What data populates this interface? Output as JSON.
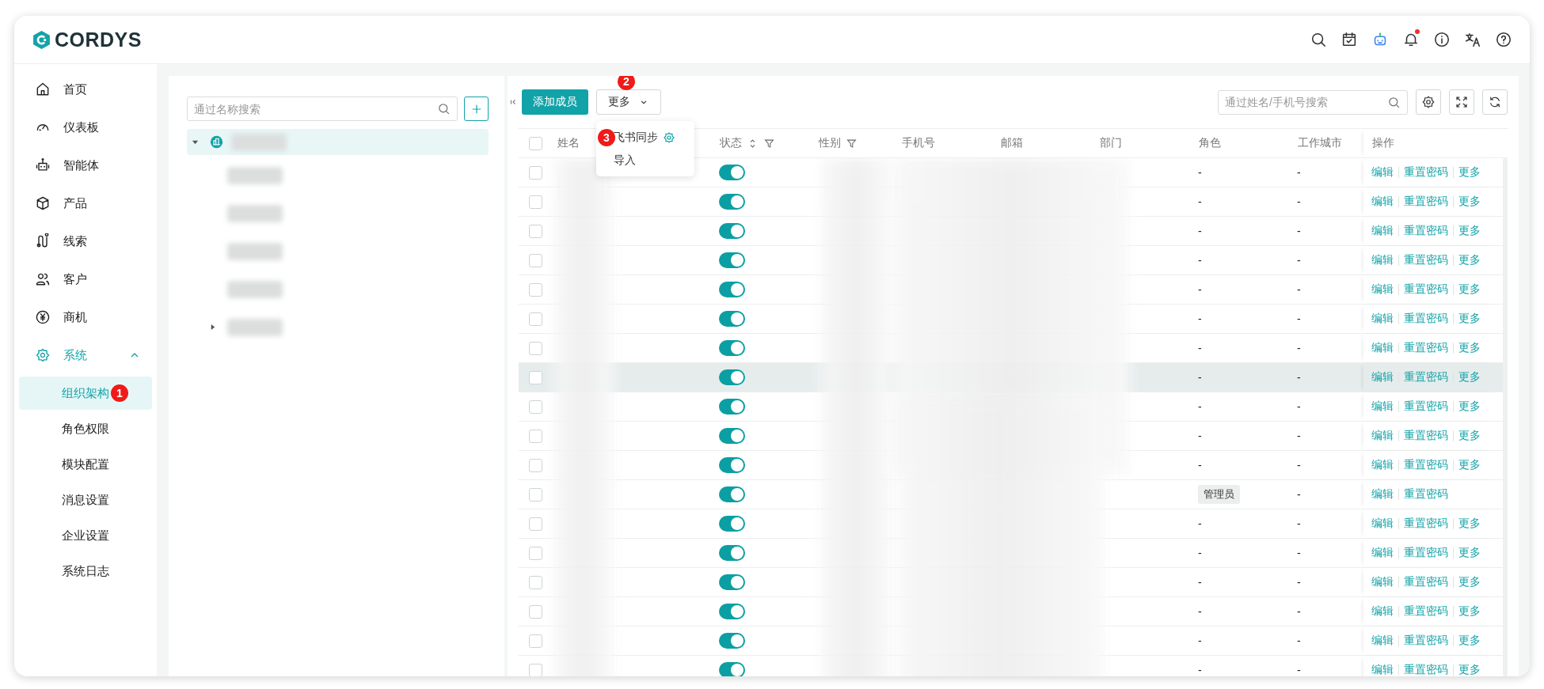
{
  "header": {
    "logo": "CORDYS",
    "notification_unread": true
  },
  "sidebar": {
    "items": [
      {
        "label": "首页",
        "selected": false
      },
      {
        "label": "仪表板",
        "selected": false
      },
      {
        "label": "智能体",
        "selected": false
      },
      {
        "label": "产品",
        "selected": false
      },
      {
        "label": "线索",
        "selected": false
      },
      {
        "label": "客户",
        "selected": false
      },
      {
        "label": "商机",
        "selected": false
      },
      {
        "label": "系统",
        "selected": true,
        "expanded": true,
        "children": [
          {
            "label": "组织架构",
            "selected": true,
            "marker": "1"
          },
          {
            "label": "角色权限",
            "selected": false
          },
          {
            "label": "模块配置",
            "selected": false
          },
          {
            "label": "消息设置",
            "selected": false
          },
          {
            "label": "企业设置",
            "selected": false
          },
          {
            "label": "系统日志",
            "selected": false
          }
        ]
      }
    ]
  },
  "tree_panel": {
    "search": {
      "placeholder": "通过名称搜索"
    },
    "tree": [
      {
        "kind": "branch",
        "expanded": true,
        "selected": true,
        "children": [
          {
            "kind": "leaf"
          },
          {
            "kind": "leaf"
          },
          {
            "kind": "leaf"
          },
          {
            "kind": "leaf"
          },
          {
            "kind": "branch",
            "expanded": false
          }
        ]
      }
    ]
  },
  "toolbar": {
    "add_button": "添加成员",
    "more_button": {
      "label": "更多",
      "marker": "2"
    },
    "more_menu": [
      {
        "label": "飞书同步",
        "marker": "3",
        "settings": true
      },
      {
        "label": "导入"
      }
    ],
    "search": {
      "placeholder": "通过姓名/手机号搜索"
    }
  },
  "table": {
    "select_all_checked": false,
    "columns": [
      {
        "label": "姓名"
      },
      {
        "label": "状态",
        "sort": true,
        "filter": true
      },
      {
        "label": "性别",
        "filter": true
      },
      {
        "label": "手机号"
      },
      {
        "label": "邮箱"
      },
      {
        "label": "部门"
      },
      {
        "label": "角色"
      },
      {
        "label": "工作城市"
      },
      {
        "label": "操作"
      }
    ],
    "rows": [
      {
        "checked": false,
        "enabled": true,
        "highlighted": false,
        "role": {
          "kind": "plain",
          "text": "-"
        },
        "city": "-",
        "actions": [
          "编辑",
          "重置密码",
          "更多"
        ]
      },
      {
        "checked": false,
        "enabled": true,
        "highlighted": false,
        "role": {
          "kind": "plain",
          "text": "-"
        },
        "city": "-",
        "actions": [
          "编辑",
          "重置密码",
          "更多"
        ]
      },
      {
        "checked": false,
        "enabled": true,
        "highlighted": false,
        "role": {
          "kind": "plain",
          "text": "-"
        },
        "city": "-",
        "actions": [
          "编辑",
          "重置密码",
          "更多"
        ]
      },
      {
        "checked": false,
        "enabled": true,
        "highlighted": false,
        "role": {
          "kind": "plain",
          "text": "-"
        },
        "city": "-",
        "actions": [
          "编辑",
          "重置密码",
          "更多"
        ]
      },
      {
        "checked": false,
        "enabled": true,
        "highlighted": false,
        "role": {
          "kind": "plain",
          "text": "-"
        },
        "city": "-",
        "actions": [
          "编辑",
          "重置密码",
          "更多"
        ]
      },
      {
        "checked": false,
        "enabled": true,
        "highlighted": false,
        "role": {
          "kind": "plain",
          "text": "-"
        },
        "city": "-",
        "actions": [
          "编辑",
          "重置密码",
          "更多"
        ]
      },
      {
        "checked": false,
        "enabled": true,
        "highlighted": false,
        "role": {
          "kind": "plain",
          "text": "-"
        },
        "city": "-",
        "actions": [
          "编辑",
          "重置密码",
          "更多"
        ]
      },
      {
        "checked": false,
        "enabled": true,
        "highlighted": true,
        "role": {
          "kind": "plain",
          "text": "-"
        },
        "city": "-",
        "actions": [
          "编辑",
          "重置密码",
          "更多"
        ]
      },
      {
        "checked": false,
        "enabled": true,
        "highlighted": false,
        "role": {
          "kind": "plain",
          "text": "-"
        },
        "city": "-",
        "actions": [
          "编辑",
          "重置密码",
          "更多"
        ]
      },
      {
        "checked": false,
        "enabled": true,
        "highlighted": false,
        "role": {
          "kind": "plain",
          "text": "-"
        },
        "city": "-",
        "actions": [
          "编辑",
          "重置密码",
          "更多"
        ]
      },
      {
        "checked": false,
        "enabled": true,
        "highlighted": false,
        "role": {
          "kind": "plain",
          "text": "-"
        },
        "city": "-",
        "actions": [
          "编辑",
          "重置密码",
          "更多"
        ]
      },
      {
        "checked": false,
        "enabled": true,
        "highlighted": false,
        "role": {
          "kind": "tag",
          "text": "管理员"
        },
        "city": "-",
        "actions": [
          "编辑",
          "重置密码"
        ]
      },
      {
        "checked": false,
        "enabled": true,
        "highlighted": false,
        "role": {
          "kind": "plain",
          "text": "-"
        },
        "city": "-",
        "actions": [
          "编辑",
          "重置密码",
          "更多"
        ]
      },
      {
        "checked": false,
        "enabled": true,
        "highlighted": false,
        "role": {
          "kind": "plain",
          "text": "-"
        },
        "city": "-",
        "actions": [
          "编辑",
          "重置密码",
          "更多"
        ]
      },
      {
        "checked": false,
        "enabled": true,
        "highlighted": false,
        "role": {
          "kind": "plain",
          "text": "-"
        },
        "city": "-",
        "actions": [
          "编辑",
          "重置密码",
          "更多"
        ]
      },
      {
        "checked": false,
        "enabled": true,
        "highlighted": false,
        "role": {
          "kind": "plain",
          "text": "-"
        },
        "city": "-",
        "actions": [
          "编辑",
          "重置密码",
          "更多"
        ]
      },
      {
        "checked": false,
        "enabled": true,
        "highlighted": false,
        "role": {
          "kind": "plain",
          "text": "-"
        },
        "city": "-",
        "actions": [
          "编辑",
          "重置密码",
          "更多"
        ]
      },
      {
        "checked": false,
        "enabled": true,
        "highlighted": false,
        "role": {
          "kind": "plain",
          "text": "-"
        },
        "city": "-",
        "actions": [
          "编辑",
          "重置密码",
          "更多"
        ]
      }
    ]
  }
}
